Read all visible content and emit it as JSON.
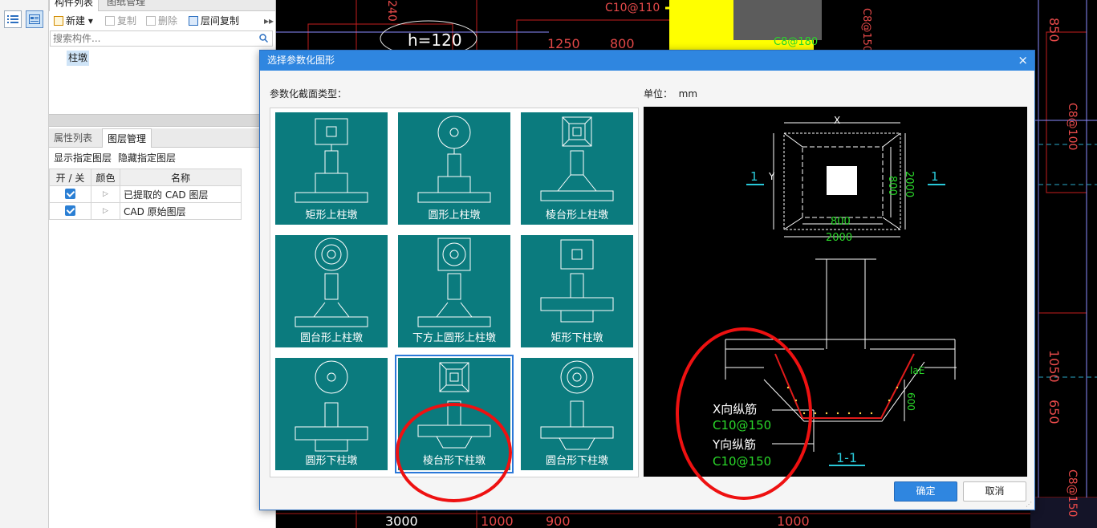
{
  "left_panel": {
    "top_tabs": [
      "构件列表",
      "图纸管理"
    ],
    "toolbar": {
      "new": "新建",
      "copy": "复制",
      "delete": "删除",
      "layer_copy": "层间复制"
    },
    "search_placeholder": "搜索构件...",
    "tree_item": "柱墩",
    "bottom_tabs": [
      "属性列表",
      "图层管理"
    ],
    "show_layers": "显示指定图层",
    "hide_layers": "隐藏指定图层",
    "table": {
      "headers": [
        "开 / 关",
        "颜色",
        "名称"
      ],
      "rows": [
        {
          "name": "已提取的 CAD 图层",
          "checked": true
        },
        {
          "name": "CAD 原始图层",
          "checked": true
        }
      ]
    }
  },
  "cad_bg": {
    "labels": [
      "h=120",
      "1250",
      "800",
      "C10@110",
      "C8@180",
      "C8@150",
      "850",
      "C8@100",
      "1050",
      "650",
      "C8@150",
      "3000",
      "1000",
      "900",
      "1000",
      "240"
    ]
  },
  "dialog": {
    "title": "选择参数化图形",
    "close": "×",
    "section_label": "参数化截面类型：",
    "unit_label": "单位：",
    "unit_value": "mm",
    "shapes": [
      {
        "label": "矩形上柱墩"
      },
      {
        "label": "圆形上柱墩"
      },
      {
        "label": "棱台形上柱墩"
      },
      {
        "label": "圆台形上柱墩"
      },
      {
        "label": "下方上圆形上柱墩"
      },
      {
        "label": "矩形下柱墩"
      },
      {
        "label": "圆形下柱墩"
      },
      {
        "label": "棱台形下柱墩"
      },
      {
        "label": "圆台形下柱墩"
      }
    ],
    "selected_shape": "棱台形下柱墩",
    "preview": {
      "dim_x": "X",
      "dim_y": "Y",
      "dim_800_a": "800",
      "dim_2000_a": "2000",
      "dim_800_b": "800",
      "dim_2000_b": "2000",
      "section_marker_left": "1",
      "section_marker_right": "1",
      "lae": "laE",
      "dim_600": "600",
      "x_rebar_label": "X向纵筋",
      "x_rebar_value": "C10@150",
      "y_rebar_label": "Y向纵筋",
      "y_rebar_value": "C10@150",
      "section_title": "1-1"
    },
    "ok": "确定",
    "cancel": "取消"
  },
  "colors": {
    "title_bar": "#2f86e0",
    "tile_bg": "#0b7b7e",
    "annotation": "#ee1111",
    "cad_yellow": "#ffff00",
    "cad_red": "#cc1a1a",
    "cad_green": "#29d829"
  }
}
